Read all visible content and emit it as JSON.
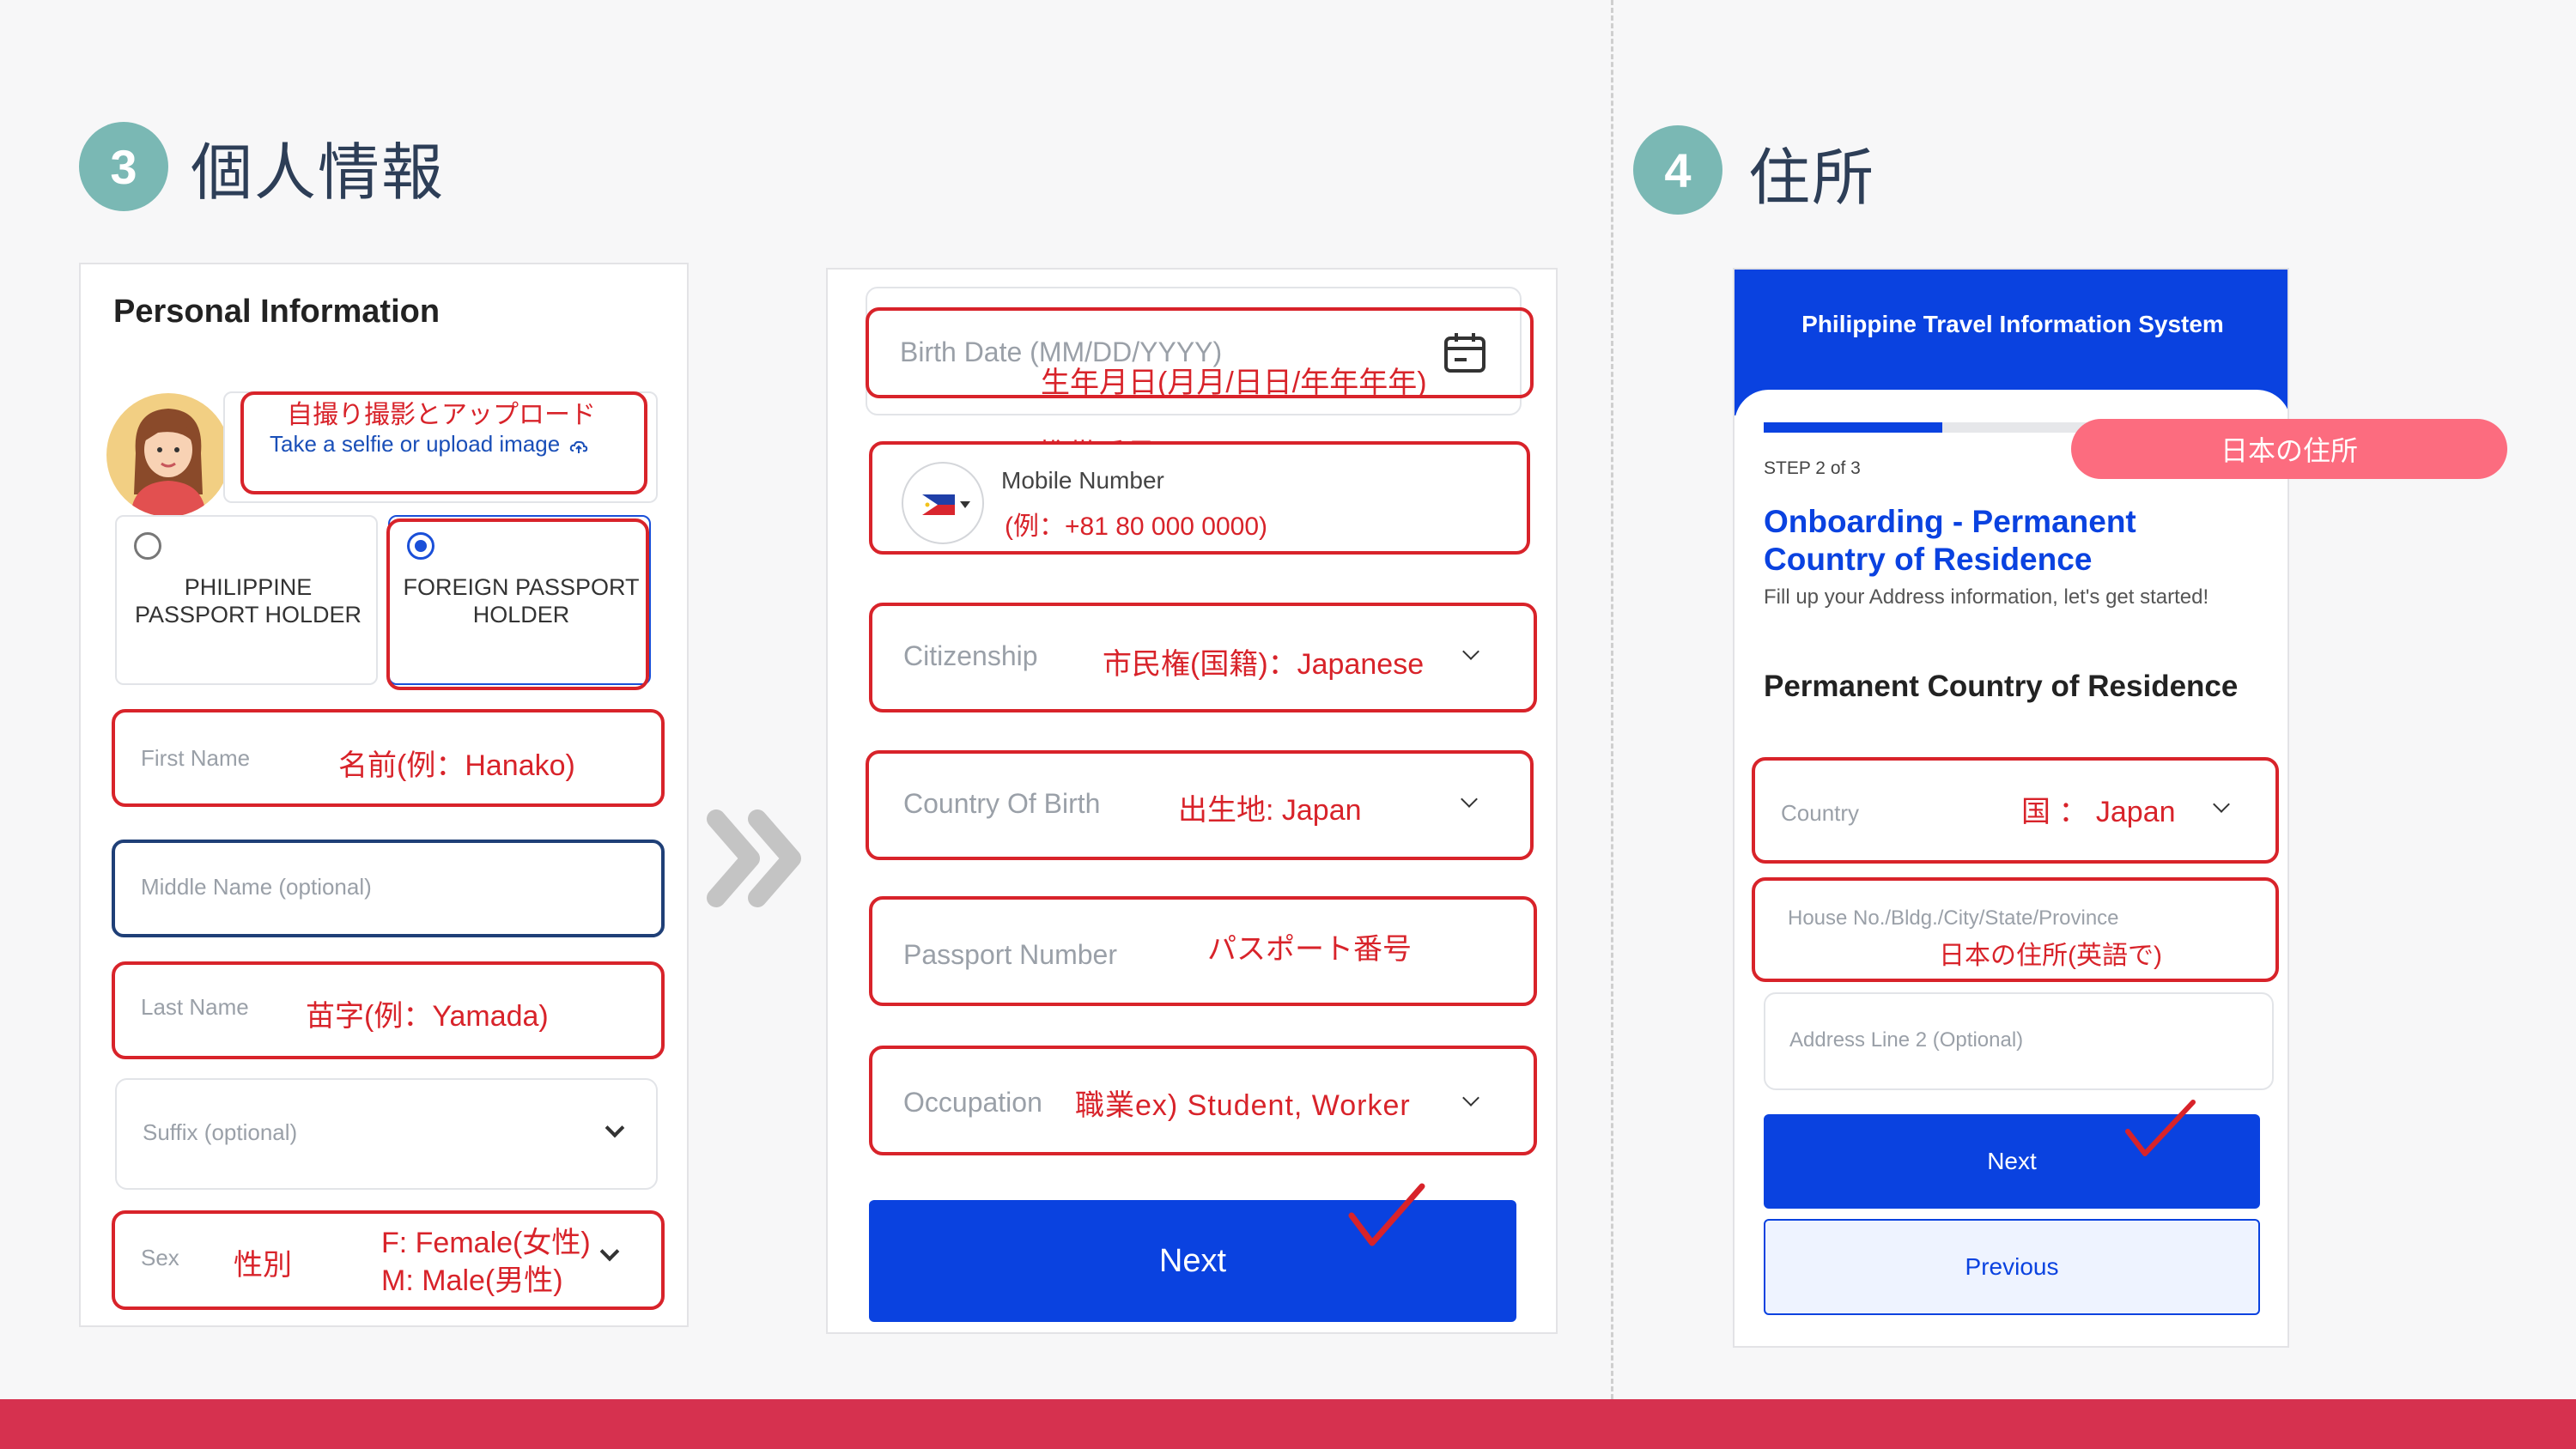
{
  "sections": {
    "personal": {
      "number": "3",
      "title": "個人情報"
    },
    "address": {
      "number": "4",
      "title": "住所"
    }
  },
  "panel1": {
    "title": "Personal Information",
    "selfie": {
      "annotation": "自撮り撮影とアップロード",
      "link": "Take a selfie or upload image"
    },
    "passport_options": [
      {
        "label": "PHILIPPINE PASSPORT HOLDER",
        "selected": false
      },
      {
        "label": "FOREIGN PASSPORT HOLDER",
        "selected": true
      }
    ],
    "first_name": {
      "placeholder": "First Name",
      "annotation": "名前(例：Hanako)"
    },
    "middle_name": {
      "placeholder": "Middle Name (optional)"
    },
    "last_name": {
      "placeholder": "Last Name",
      "annotation": "苗字(例：Yamada)"
    },
    "suffix": {
      "placeholder": "Suffix (optional)"
    },
    "sex": {
      "placeholder": "Sex",
      "annotation": "性別",
      "options_note_1": "F: Female(女性)",
      "options_note_2": "M: Male(男性)"
    }
  },
  "panel2": {
    "birth_date": {
      "placeholder": "Birth Date (MM/DD/YYYY)",
      "annotation": "生年月日(月月/日日/年年年年)"
    },
    "mobile": {
      "annotation": "携帯番号",
      "label": "Mobile Number",
      "example": "(例：+81 80 000 0000)"
    },
    "citizenship": {
      "placeholder": "Citizenship",
      "annotation": "市民権(国籍)：Japanese"
    },
    "country_of_birth": {
      "placeholder": "Country Of Birth",
      "annotation": "出生地: Japan"
    },
    "passport_number": {
      "placeholder": "Passport Number",
      "annotation": "パスポート番号"
    },
    "occupation": {
      "placeholder": "Occupation",
      "annotation": "職業ex) Student, Worker"
    },
    "next_label": "Next"
  },
  "panel3": {
    "header": "Philippine Travel Information System",
    "progress": 0.36,
    "step": "STEP 2 of 3",
    "annotation_pill": "日本の住所",
    "heading": "Onboarding - Permanent Country of Residence",
    "subheading": "Fill up your Address information, let's get started!",
    "section_title": "Permanent Country of Residence",
    "country": {
      "placeholder": "Country",
      "annotation": "国 ： Japan"
    },
    "address1": {
      "placeholder": "House No./Bldg./City/State/Province",
      "annotation": "日本の住所(英語で)"
    },
    "address2": {
      "placeholder": "Address Line 2 (Optional)"
    },
    "next_label": "Next",
    "previous_label": "Previous"
  },
  "colors": {
    "accent": "#0a42e0",
    "annotation_red": "#d8232a",
    "badge_teal": "#7ab8b4",
    "bottom_bar": "#d6314f",
    "pill_pink": "#fc6c7f"
  }
}
